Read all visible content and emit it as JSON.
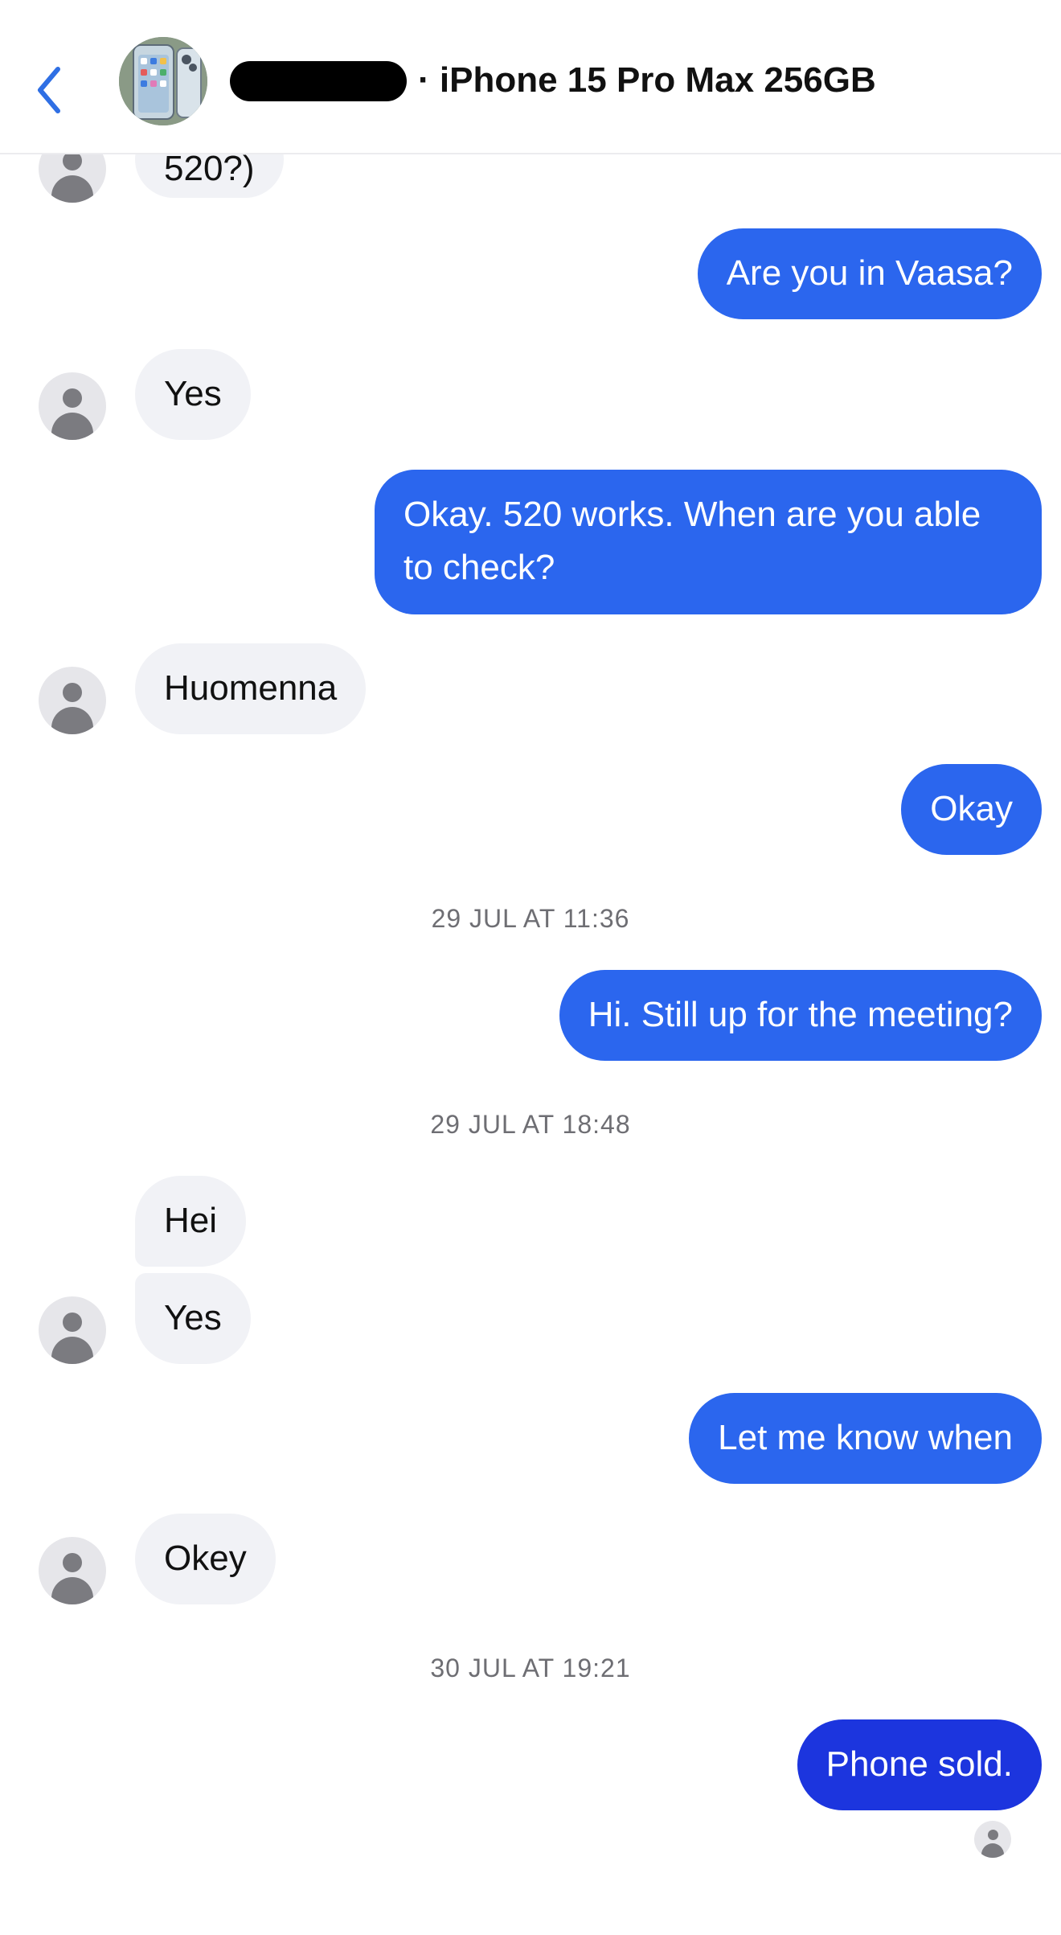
{
  "header": {
    "back_label": "Back",
    "title": "· iPhone 15 Pro Max 256GB"
  },
  "messages": [
    {
      "dir": "in",
      "text": "520?)"
    },
    {
      "dir": "out",
      "text": "Are you in Vaasa?"
    },
    {
      "dir": "in",
      "text": "Yes"
    },
    {
      "dir": "out",
      "text": "Okay. 520 works. When are you able to check?"
    },
    {
      "dir": "in",
      "text": "Huomenna"
    },
    {
      "dir": "out",
      "text": "Okay"
    },
    {
      "type": "timestamp",
      "text": "29 JUL AT 11:36"
    },
    {
      "dir": "out",
      "text": "Hi. Still up for the meeting?"
    },
    {
      "type": "timestamp",
      "text": "29 JUL AT 18:48"
    },
    {
      "dir": "in",
      "text": "Hei"
    },
    {
      "dir": "in",
      "text": "Yes"
    },
    {
      "dir": "out",
      "text": "Let me know when"
    },
    {
      "dir": "in",
      "text": "Okey"
    },
    {
      "type": "timestamp",
      "text": "30 JUL AT 19:21"
    },
    {
      "dir": "out",
      "text": "Phone sold."
    }
  ],
  "colors": {
    "outgoing_bubble": "#2b66ee",
    "outgoing_bubble_last": "#1c35de",
    "incoming_bubble": "#f1f2f6",
    "accent": "#2f6fe4"
  }
}
